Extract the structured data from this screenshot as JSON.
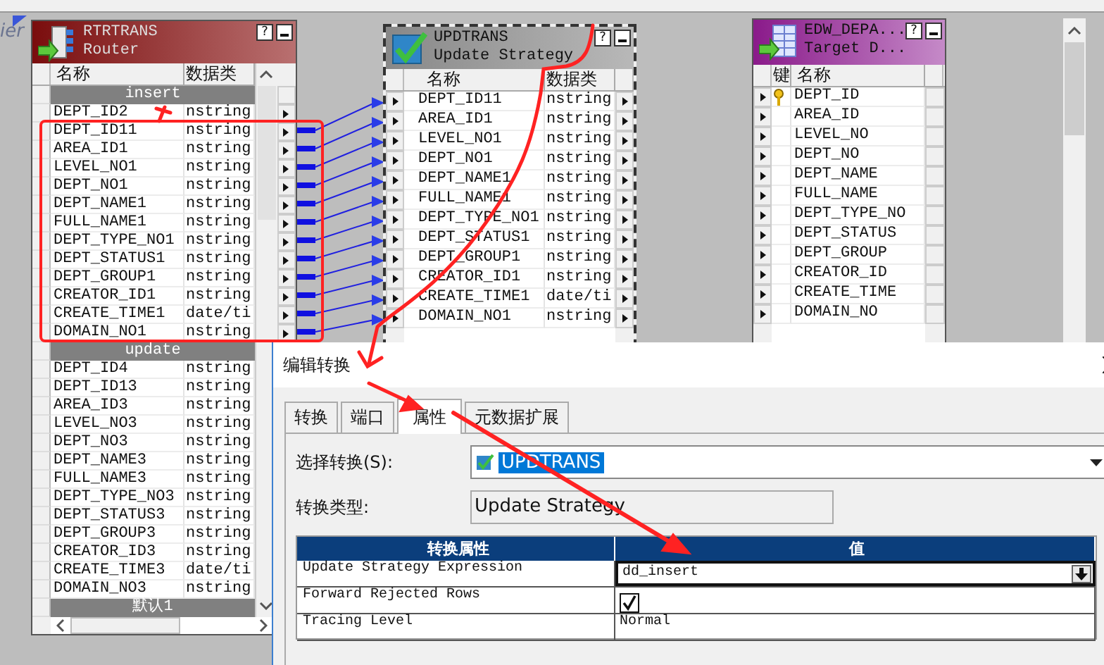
{
  "canvas": {
    "stray_label": "ier"
  },
  "router": {
    "name": "RTRTRANS",
    "type": "Router",
    "help": "?",
    "columns": [
      "名称",
      "数据类"
    ],
    "groups": [
      {
        "name": "insert",
        "ports": [
          {
            "name": "DEPT_ID2",
            "type": "nstring",
            "linked": false
          },
          {
            "name": "DEPT_ID11",
            "type": "nstring",
            "linked": true
          },
          {
            "name": "AREA_ID1",
            "type": "nstring",
            "linked": true
          },
          {
            "name": "LEVEL_NO1",
            "type": "nstring",
            "linked": true
          },
          {
            "name": "DEPT_NO1",
            "type": "nstring",
            "linked": true
          },
          {
            "name": "DEPT_NAME1",
            "type": "nstring",
            "linked": true
          },
          {
            "name": "FULL_NAME1",
            "type": "nstring",
            "linked": true
          },
          {
            "name": "DEPT_TYPE_NO1",
            "type": "nstring",
            "linked": true
          },
          {
            "name": "DEPT_STATUS1",
            "type": "nstring",
            "linked": true
          },
          {
            "name": "DEPT_GROUP1",
            "type": "nstring",
            "linked": true
          },
          {
            "name": "CREATOR_ID1",
            "type": "nstring",
            "linked": true
          },
          {
            "name": "CREATE_TIME1",
            "type": "date/ti",
            "linked": true
          },
          {
            "name": "DOMAIN_NO1",
            "type": "nstring",
            "linked": true
          }
        ]
      },
      {
        "name": "update",
        "ports": [
          {
            "name": "DEPT_ID4",
            "type": "nstring",
            "linked": false
          },
          {
            "name": "DEPT_ID13",
            "type": "nstring",
            "linked": false
          },
          {
            "name": "AREA_ID3",
            "type": "nstring",
            "linked": false
          },
          {
            "name": "LEVEL_NO3",
            "type": "nstring",
            "linked": false
          },
          {
            "name": "DEPT_NO3",
            "type": "nstring",
            "linked": false
          },
          {
            "name": "DEPT_NAME3",
            "type": "nstring",
            "linked": false
          },
          {
            "name": "FULL_NAME3",
            "type": "nstring",
            "linked": false
          },
          {
            "name": "DEPT_TYPE_NO3",
            "type": "nstring",
            "linked": false
          },
          {
            "name": "DEPT_STATUS3",
            "type": "nstring",
            "linked": false
          },
          {
            "name": "DEPT_GROUP3",
            "type": "nstring",
            "linked": false
          },
          {
            "name": "CREATOR_ID3",
            "type": "nstring",
            "linked": false
          },
          {
            "name": "CREATE_TIME3",
            "type": "date/ti",
            "linked": false
          },
          {
            "name": "DOMAIN_NO3",
            "type": "nstring",
            "linked": false
          }
        ]
      },
      {
        "name": "默认1"
      }
    ]
  },
  "update_strategy": {
    "name": "UPDTRANS",
    "type": "Update Strategy",
    "help": "?",
    "columns": [
      "名称",
      "数据类"
    ],
    "ports": [
      {
        "name": "DEPT_ID11",
        "type": "nstring"
      },
      {
        "name": "AREA_ID1",
        "type": "nstring"
      },
      {
        "name": "LEVEL_NO1",
        "type": "nstring"
      },
      {
        "name": "DEPT_NO1",
        "type": "nstring"
      },
      {
        "name": "DEPT_NAME1",
        "type": "nstring"
      },
      {
        "name": "FULL_NAME1",
        "type": "nstring"
      },
      {
        "name": "DEPT_TYPE_NO1",
        "type": "nstring"
      },
      {
        "name": "DEPT_STATUS1",
        "type": "nstring"
      },
      {
        "name": "DEPT_GROUP1",
        "type": "nstring"
      },
      {
        "name": "CREATOR_ID1",
        "type": "nstring"
      },
      {
        "name": "CREATE_TIME1",
        "type": "date/ti"
      },
      {
        "name": "DOMAIN_NO1",
        "type": "nstring"
      }
    ]
  },
  "target": {
    "name": "EDW_DEPA...",
    "type": "Target D...",
    "help": "?",
    "columns": [
      "键",
      "名称"
    ],
    "ports": [
      {
        "name": "DEPT_ID",
        "key": true
      },
      {
        "name": "AREA_ID",
        "key": false
      },
      {
        "name": "LEVEL_NO",
        "key": false
      },
      {
        "name": "DEPT_NO",
        "key": false
      },
      {
        "name": "DEPT_NAME",
        "key": false
      },
      {
        "name": "FULL_NAME",
        "key": false
      },
      {
        "name": "DEPT_TYPE_NO",
        "key": false
      },
      {
        "name": "DEPT_STATUS",
        "key": false
      },
      {
        "name": "DEPT_GROUP",
        "key": false
      },
      {
        "name": "CREATOR_ID",
        "key": false
      },
      {
        "name": "CREATE_TIME",
        "key": false
      },
      {
        "name": "DOMAIN_NO",
        "key": false
      }
    ]
  },
  "dialog": {
    "title": "编辑转换",
    "tabs": [
      {
        "label": "转换",
        "selected": false
      },
      {
        "label": "端口",
        "selected": false
      },
      {
        "label": "属性",
        "selected": true
      },
      {
        "label": "元数据扩展",
        "selected": false
      }
    ],
    "select_label": "选择转换(S):",
    "select_value": "UPDTRANS",
    "type_label": "转换类型:",
    "type_value": "Update Strategy",
    "table": {
      "columns": [
        "转换属性",
        "值"
      ],
      "rows": [
        {
          "name": "Update Strategy Expression",
          "kind": "dropdown",
          "value": "dd_insert"
        },
        {
          "name": "Forward Rejected Rows",
          "kind": "checkbox",
          "checked": true
        },
        {
          "name": "Tracing Level",
          "kind": "text",
          "value": "Normal"
        }
      ]
    }
  }
}
